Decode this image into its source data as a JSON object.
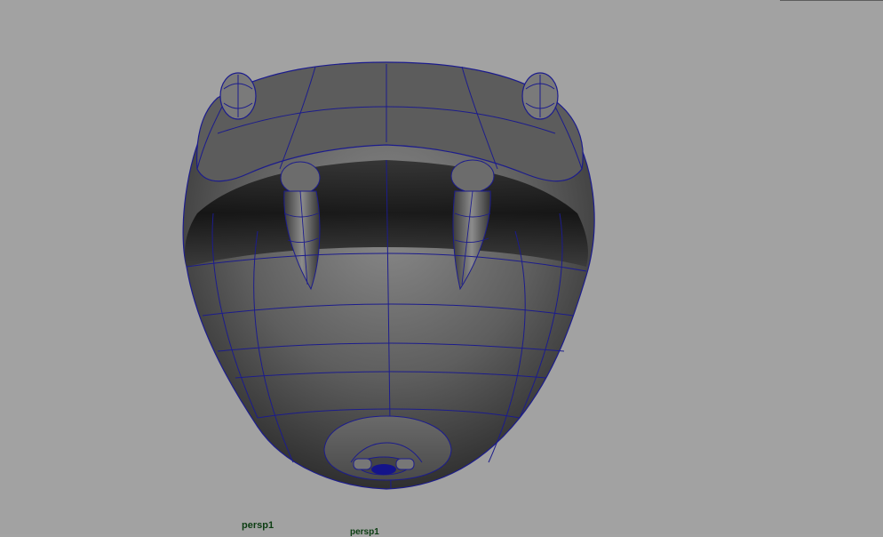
{
  "viewport": {
    "background": "#a2a2a2",
    "wire_color": "#1c1c8c",
    "camera_label": "persp1",
    "ghost_label": "persp1"
  },
  "model": {
    "name_icon": "snake-head-model-icon"
  }
}
